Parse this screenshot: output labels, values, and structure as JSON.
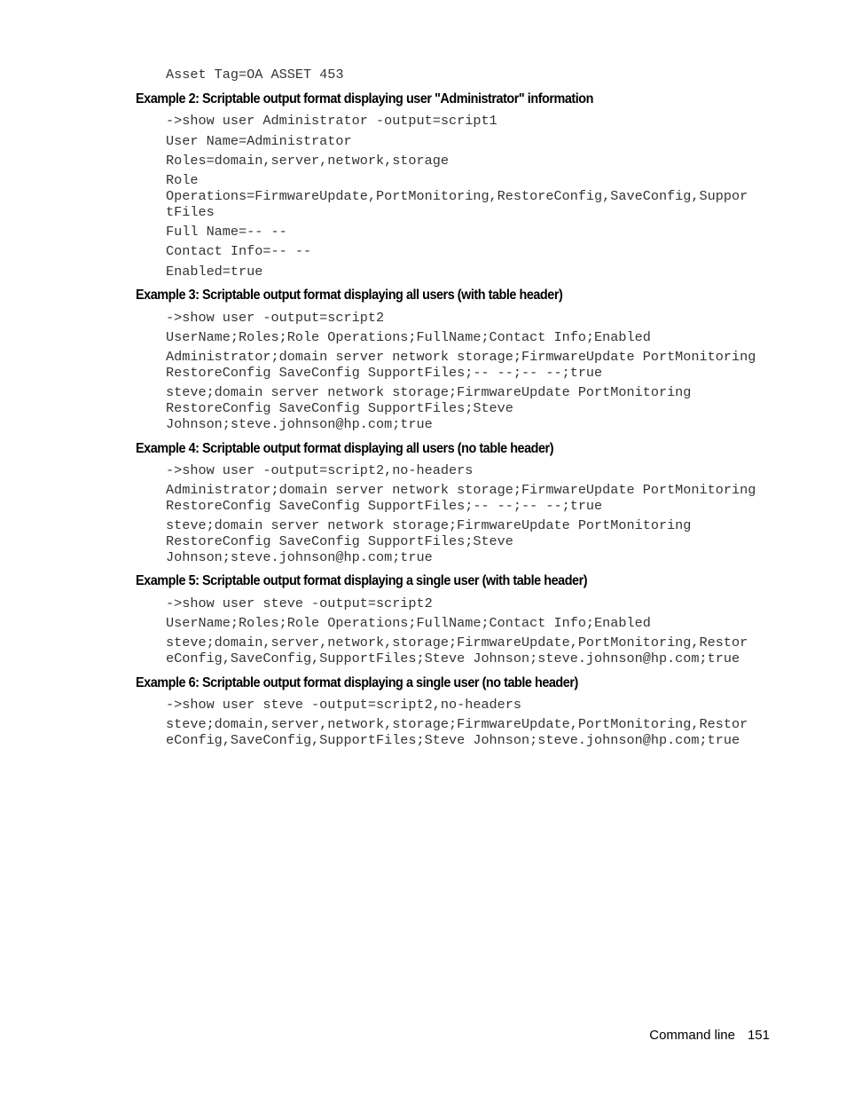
{
  "top_line": "Asset Tag=OA ASSET 453",
  "examples": [
    {
      "heading": "Example 2: Scriptable output format displaying user \"Administrator\" information",
      "lines": [
        "->show user Administrator -output=script1",
        "User Name=Administrator",
        "Roles=domain,server,network,storage",
        "Role\nOperations=FirmwareUpdate,PortMonitoring,RestoreConfig,SaveConfig,Suppor\ntFiles",
        "Full Name=-- --",
        "Contact Info=-- --",
        "Enabled=true"
      ]
    },
    {
      "heading": "Example 3: Scriptable output format displaying all users (with table header)",
      "lines": [
        "->show user -output=script2",
        "UserName;Roles;Role Operations;FullName;Contact Info;Enabled",
        "Administrator;domain server network storage;FirmwareUpdate PortMonitoring\nRestoreConfig SaveConfig SupportFiles;-- --;-- --;true",
        "steve;domain server network storage;FirmwareUpdate PortMonitoring\nRestoreConfig SaveConfig SupportFiles;Steve\nJohnson;steve.johnson@hp.com;true"
      ]
    },
    {
      "heading": "Example 4: Scriptable output format displaying all users (no table header)",
      "lines": [
        "->show user -output=script2,no-headers",
        "Administrator;domain server network storage;FirmwareUpdate PortMonitoring\nRestoreConfig SaveConfig SupportFiles;-- --;-- --;true",
        "steve;domain server network storage;FirmwareUpdate PortMonitoring\nRestoreConfig SaveConfig SupportFiles;Steve\nJohnson;steve.johnson@hp.com;true"
      ]
    },
    {
      "heading": "Example 5: Scriptable output format displaying a single user (with table header)",
      "lines": [
        "->show user steve -output=script2",
        "UserName;Roles;Role Operations;FullName;Contact Info;Enabled",
        "steve;domain,server,network,storage;FirmwareUpdate,PortMonitoring,Restor\neConfig,SaveConfig,SupportFiles;Steve Johnson;steve.johnson@hp.com;true"
      ]
    },
    {
      "heading": "Example 6: Scriptable output format displaying a single user (no table header)",
      "lines": [
        "->show user steve -output=script2,no-headers",
        "steve;domain,server,network,storage;FirmwareUpdate,PortMonitoring,Restor\neConfig,SaveConfig,SupportFiles;Steve Johnson;steve.johnson@hp.com;true"
      ]
    }
  ],
  "footer": {
    "section": "Command line",
    "page_number": "151"
  }
}
